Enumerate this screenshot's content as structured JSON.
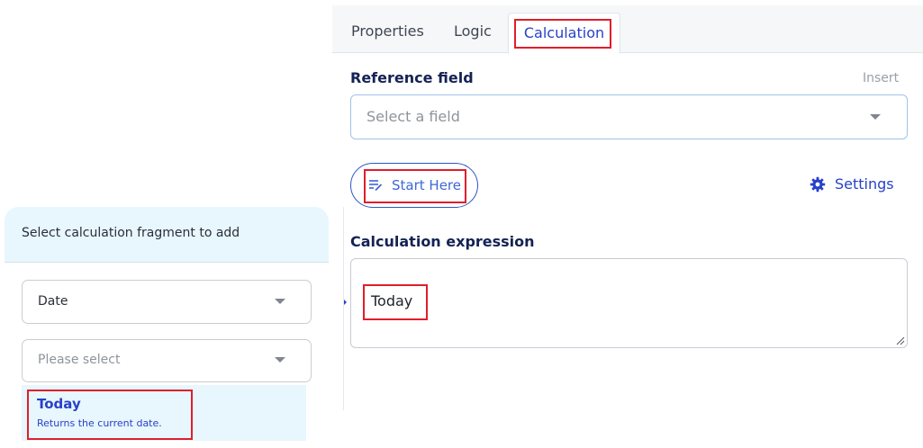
{
  "tabs": [
    {
      "label": "Properties"
    },
    {
      "label": "Logic"
    },
    {
      "label": "Calculation"
    }
  ],
  "reference": {
    "label": "Reference field",
    "insert_label": "Insert",
    "placeholder": "Select a field"
  },
  "actions": {
    "start_label": "Start Here",
    "settings_label": "Settings"
  },
  "expression": {
    "label": "Calculation expression",
    "value": "Today"
  },
  "fragment": {
    "title": "Select calculation fragment to add",
    "category_value": "Date",
    "function_placeholder": "Please select",
    "options": [
      {
        "name": "Today",
        "description": "Returns the current date."
      }
    ]
  },
  "colors": {
    "accent": "#2741c9",
    "highlight": "#e01e2b",
    "popover_header": "#e8f6fd"
  }
}
